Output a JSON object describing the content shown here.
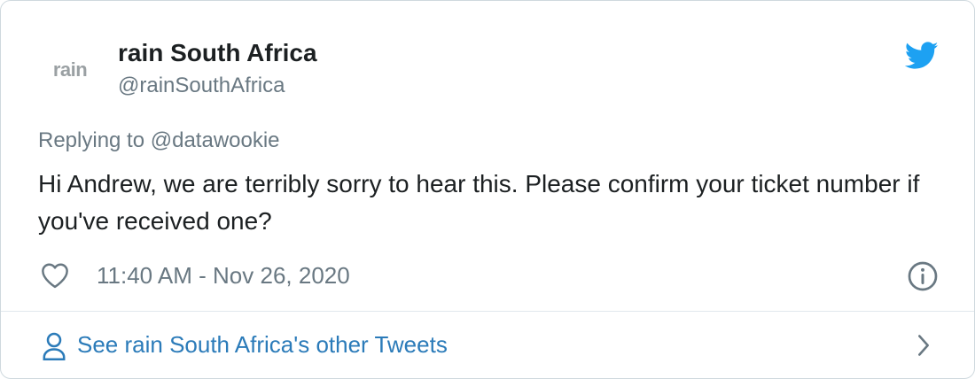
{
  "author": {
    "avatar_text": "rain",
    "name": "rain South Africa",
    "handle": "@rainSouthAfrica"
  },
  "tweet": {
    "replying_to": "Replying to @datawookie",
    "text": "Hi Andrew, we are terribly sorry to hear this. Please confirm your ticket number if you've received one?",
    "timestamp": "11:40 AM - Nov 26, 2020"
  },
  "footer": {
    "link_text": "See rain South Africa's other Tweets"
  },
  "colors": {
    "twitter_blue": "#1da1f2",
    "link_blue": "#2b7bb9",
    "secondary_text": "#697882",
    "border": "#cfd9de"
  },
  "icons": [
    "twitter-logo-icon",
    "heart-icon",
    "info-icon",
    "person-icon",
    "chevron-right-icon"
  ]
}
